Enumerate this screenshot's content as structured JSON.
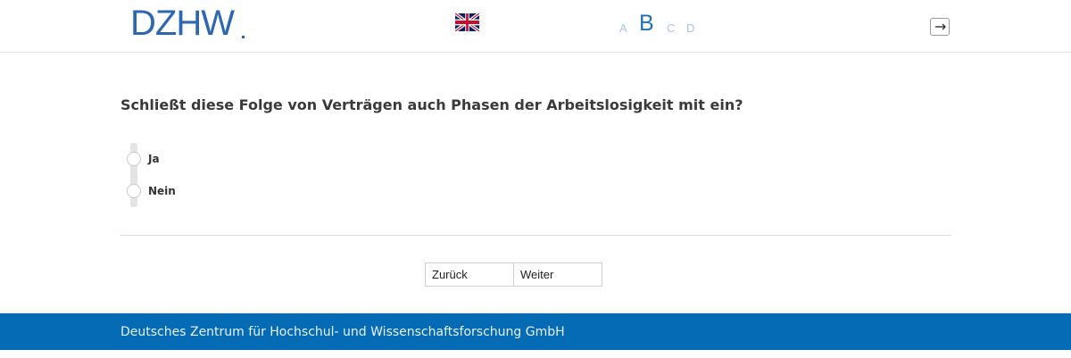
{
  "header": {
    "logo_text": "DZHW",
    "language_icon": "uk-flag-icon",
    "modules": {
      "a": "A",
      "b": "B",
      "c": "C",
      "d": "D",
      "current": "B"
    },
    "logout_icon": "logout-icon"
  },
  "question": {
    "text": "Schließt diese Folge von Verträgen auch Phasen der Arbeitslosigkeit mit ein?",
    "options": [
      {
        "label": "Ja",
        "selected": false
      },
      {
        "label": "Nein",
        "selected": false
      }
    ]
  },
  "navigation": {
    "back_label": "Zurück",
    "next_label": "Weiter"
  },
  "footer": {
    "text": "Deutsches Zentrum für Hochschul- und Wissenschaftsforschung GmbH"
  },
  "colors": {
    "brand": "#2b68b1",
    "footer_bg": "#056bb4",
    "module_active": "#1f73b5",
    "module_inactive": "#a7c6e3"
  }
}
